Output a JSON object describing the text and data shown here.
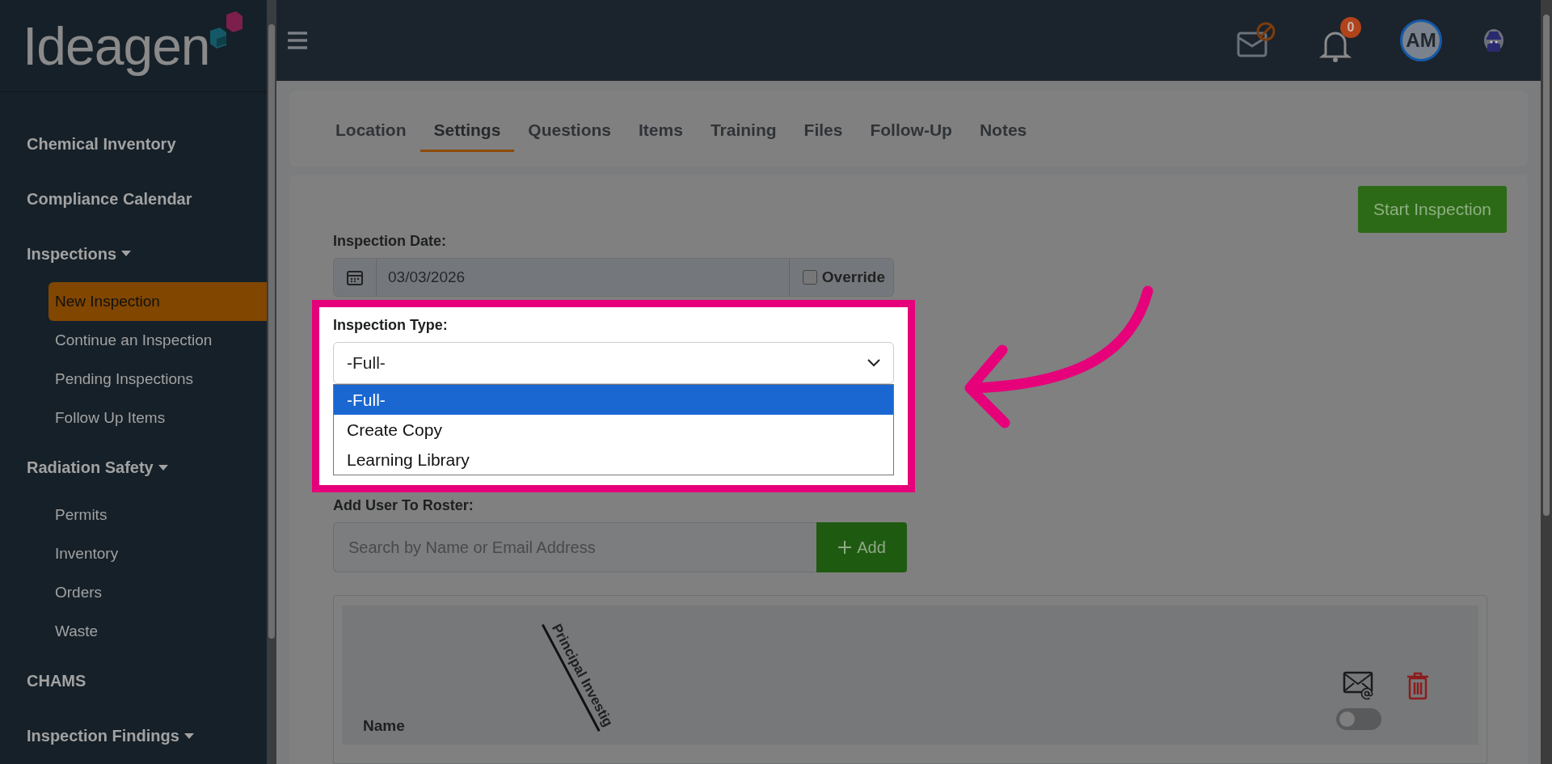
{
  "logo": {
    "text": "Ideagen"
  },
  "sidebar": {
    "items": [
      {
        "label": "Chemical Inventory",
        "kind": "link"
      },
      {
        "label": "Compliance Calendar",
        "kind": "link"
      },
      {
        "label": "Inspections",
        "kind": "group",
        "expanded": true,
        "children": [
          {
            "label": "New Inspection",
            "selected": true
          },
          {
            "label": "Continue an Inspection",
            "selected": false
          },
          {
            "label": "Pending Inspections",
            "selected": false
          },
          {
            "label": "Follow Up Items",
            "selected": false
          }
        ]
      },
      {
        "label": "Radiation Safety",
        "kind": "group",
        "expanded": true,
        "children": [
          {
            "label": "Permits",
            "selected": false
          },
          {
            "label": "Inventory",
            "selected": false
          },
          {
            "label": "Orders",
            "selected": false
          },
          {
            "label": "Waste",
            "selected": false
          }
        ]
      },
      {
        "label": "CHAMS",
        "kind": "link"
      },
      {
        "label": "Inspection Findings",
        "kind": "group",
        "expanded": true
      }
    ]
  },
  "header": {
    "notification_count": "0",
    "avatar_initials": "AM"
  },
  "tabs": [
    {
      "label": "Location",
      "selected": false
    },
    {
      "label": "Settings",
      "selected": true
    },
    {
      "label": "Questions",
      "selected": false
    },
    {
      "label": "Items",
      "selected": false
    },
    {
      "label": "Training",
      "selected": false
    },
    {
      "label": "Files",
      "selected": false
    },
    {
      "label": "Follow-Up",
      "selected": false
    },
    {
      "label": "Notes",
      "selected": false
    }
  ],
  "start_button": "Start Inspection",
  "inspection_date": {
    "label": "Inspection Date:",
    "value": "03/03/2026",
    "override": {
      "label": "Override",
      "checked": false
    }
  },
  "inspection_type": {
    "label": "Inspection Type:",
    "value": "-Full-",
    "options": [
      {
        "label": "-Full-",
        "selected": true
      },
      {
        "label": "Create Copy",
        "selected": false
      },
      {
        "label": "Learning Library",
        "selected": false
      }
    ]
  },
  "roster": {
    "label": "Add User To Roster:",
    "placeholder": "Search by Name or Email Address",
    "add_button": "Add"
  },
  "table": {
    "columns": [
      "Name",
      "Principal Investig"
    ],
    "email_toggle": {
      "on": false
    }
  }
}
